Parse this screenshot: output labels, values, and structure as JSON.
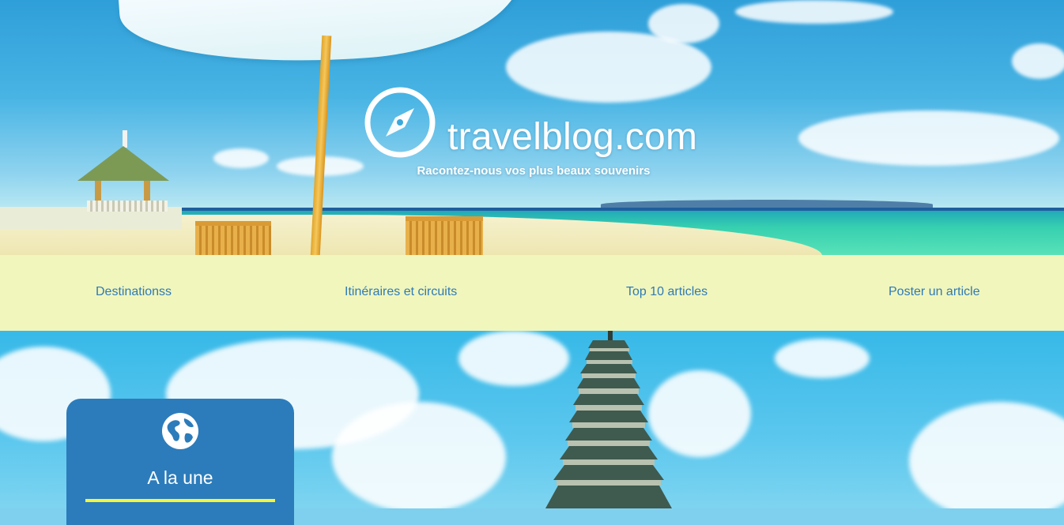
{
  "site": {
    "name": "travelblog.com",
    "tagline": "Racontez-nous vos plus beaux souvenirs"
  },
  "nav": {
    "items": [
      {
        "label": "Destinationss"
      },
      {
        "label": "Itinéraires et circuits"
      },
      {
        "label": "Top 10 articles"
      },
      {
        "label": "Poster un article"
      }
    ]
  },
  "featured": {
    "title": "A la une"
  },
  "colors": {
    "nav_background": "#f1f6bc",
    "nav_link": "#2e7ab8",
    "card_background": "#2c7cbb",
    "card_accent": "#f6f53a"
  },
  "icons": {
    "logo": "compass-icon",
    "featured": "globe-icon"
  }
}
